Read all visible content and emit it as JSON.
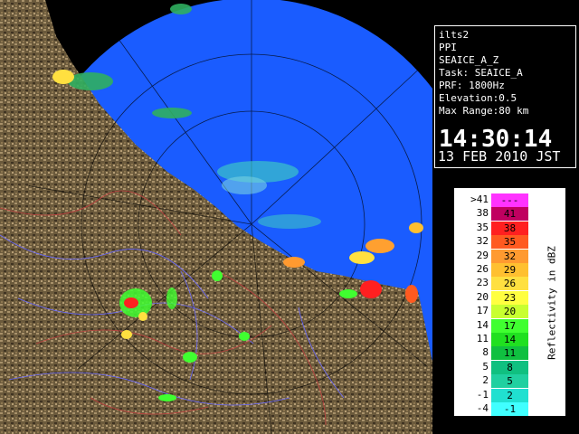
{
  "info": {
    "lines": [
      "ilts2",
      "PPI",
      "SEAICE_A_Z",
      "Task: SEAICE_A",
      "PRF: 1800Hz",
      "Elevation:0.5",
      "Max Range:80 km"
    ],
    "time": "14:30:14",
    "date": "13 FEB 2010 JST"
  },
  "legend": {
    "title": "Reflectivity in dBZ",
    "rows": [
      {
        "left": ">41",
        "right": "---",
        "color": "#ff33ff"
      },
      {
        "left": "38",
        "right": "41",
        "color": "#c00060"
      },
      {
        "left": "35",
        "right": "38",
        "color": "#ff2020"
      },
      {
        "left": "32",
        "right": "35",
        "color": "#ff5a20"
      },
      {
        "left": "29",
        "right": "32",
        "color": "#ff9a30"
      },
      {
        "left": "26",
        "right": "29",
        "color": "#ffc030"
      },
      {
        "left": "23",
        "right": "26",
        "color": "#ffe040"
      },
      {
        "left": "20",
        "right": "23",
        "color": "#ffff40"
      },
      {
        "left": "17",
        "right": "20",
        "color": "#c8ff30"
      },
      {
        "left": "14",
        "right": "17",
        "color": "#40ff30"
      },
      {
        "left": "11",
        "right": "14",
        "color": "#20e020"
      },
      {
        "left": "8",
        "right": "11",
        "color": "#10c040"
      },
      {
        "left": "5",
        "right": "8",
        "color": "#10c080"
      },
      {
        "left": "2",
        "right": "5",
        "color": "#20d0a0"
      },
      {
        "left": "-1",
        "right": "2",
        "color": "#20e0d0"
      },
      {
        "left": "-4",
        "right": "-1",
        "color": "#40ffff"
      }
    ]
  },
  "colors": {
    "sea": "#1a5cff",
    "sea_outside": "#000000",
    "land": "#6b5a3c",
    "range_ring": "#000000",
    "clutter_light": "#40d0c0"
  }
}
